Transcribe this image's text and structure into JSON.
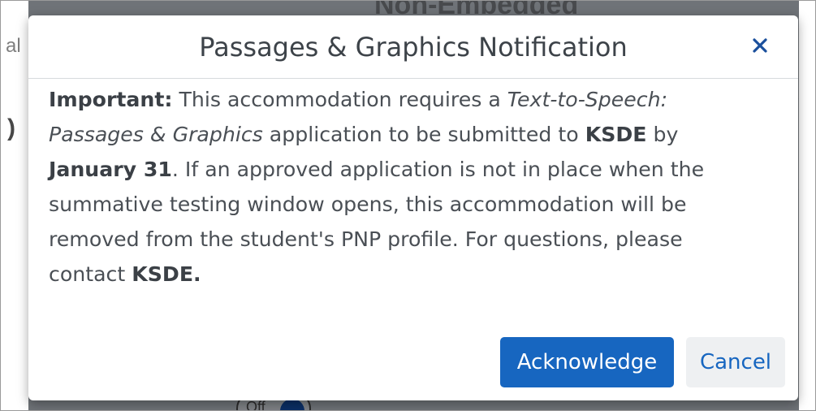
{
  "background": {
    "heading_partial": "Non-Embedded",
    "left_char": "al",
    "left_paren": ")",
    "toggle_label": "Off"
  },
  "modal": {
    "title": "Passages & Graphics Notification",
    "close_icon": "close-icon",
    "body": {
      "important_label": "Important:",
      "text_1": " This accommodation requires a ",
      "italic_app": "Text-to-Speech: Passages & Graphics",
      "text_2": " application to be submitted to ",
      "org_1": "KSDE",
      "text_3": " by ",
      "deadline": "January 31",
      "text_4": ". If an approved application is not in place when the summative testing window opens, this accommodation will be removed from the student's PNP profile. For questions, please contact ",
      "org_2": "KSDE."
    },
    "buttons": {
      "acknowledge": "Acknowledge",
      "cancel": "Cancel"
    }
  },
  "colors": {
    "primary": "#1766c0",
    "overlay": "#7f7f7f",
    "title_text": "#3d4349",
    "body_text": "#4a4f55"
  }
}
